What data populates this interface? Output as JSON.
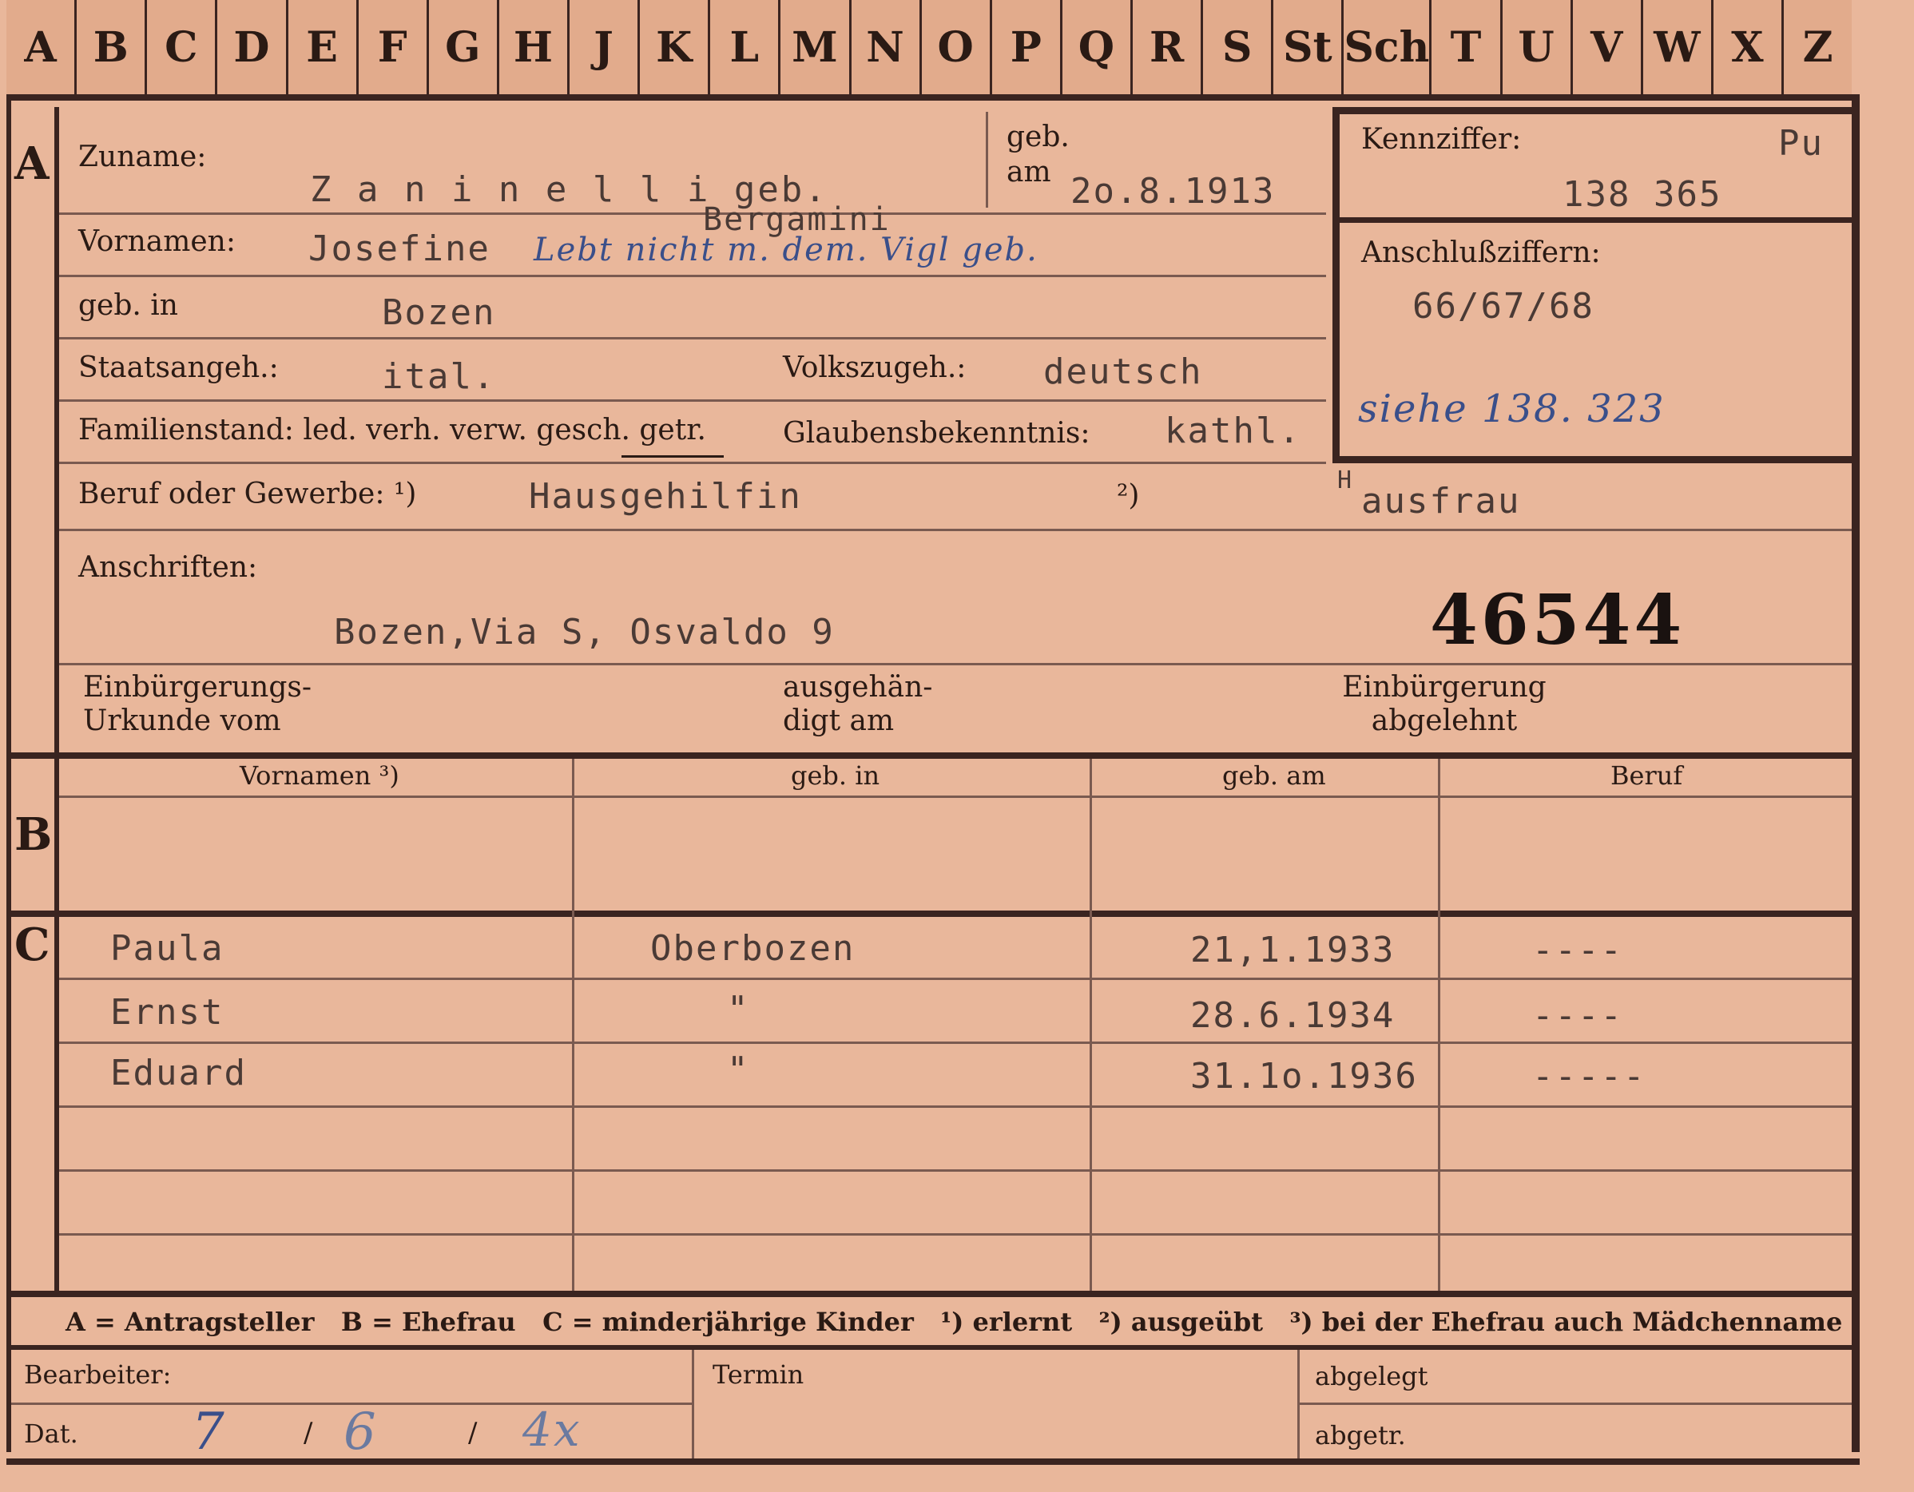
{
  "alphabet": [
    "A",
    "B",
    "C",
    "D",
    "E",
    "F",
    "G",
    "H",
    "J",
    "K",
    "L",
    "M",
    "N",
    "O",
    "P",
    "Q",
    "R",
    "S",
    "St",
    "Sch",
    "T",
    "U",
    "V",
    "W",
    "X",
    "Z"
  ],
  "section_a": {
    "letter": "A",
    "surname_label": "Zuname:",
    "surname_value": "Z a n i n e l l i  geb.",
    "surname_above": "Bergamini",
    "born_on_label": "geb. am",
    "born_on_value": "2o.8.1913",
    "first_names_label": "Vornamen:",
    "first_names_value": "Josefine",
    "first_names_note": "Lebt nicht m. dem. Vigl geb.",
    "born_in_label": "geb. in",
    "born_in_value": "Bozen",
    "citizenship_label": "Staatsangeh.:",
    "citizenship_value": "ital.",
    "ethnicity_label": "Volkszugeh.:",
    "ethnicity_value": "deutsch",
    "marital_label": "Familienstand: led. verh. verw. gesch. getr.",
    "religion_label": "Glaubensbekenntnis:",
    "religion_value": "kathl.",
    "occupation_label": "Beruf oder Gewerbe: ¹)",
    "occupation_value": "Hausgehilfin",
    "occupation2_marker": "²)",
    "occupation2_value": "ausfrau",
    "occupation2_prefix": "H",
    "address_label": "Anschriften:",
    "address_value": "Bozen,Via  S, Osvaldo   9",
    "big_number": "46544",
    "naturalization_label": "Einbürgerungs- Urkunde vom",
    "handed_label": "ausgehän- digt am",
    "rejected_label": "Einbürgerung abgelehnt"
  },
  "id_box": {
    "code_label": "Kennziffer:",
    "code_prefix": "Pu",
    "code_value": "138 365",
    "link_label": "Anschlußziffern:",
    "link_value": "66/67/68",
    "see_note": "siehe 138. 323"
  },
  "section_b": {
    "letter": "B",
    "headers": [
      "Vornamen ³)",
      "geb. in",
      "geb. am",
      "Beruf"
    ]
  },
  "section_c": {
    "letter": "C",
    "rows": [
      {
        "name": "Paula",
        "place": "Oberbozen",
        "date": "21,1.1933",
        "job": "----"
      },
      {
        "name": "Ernst",
        "place": "\"",
        "date": "28.6.1934",
        "job": "----"
      },
      {
        "name": "Eduard",
        "place": "\"",
        "date": "31.1o.1936",
        "job": "-----"
      }
    ]
  },
  "legend": "A = Antragsteller   B = Ehefrau   C = minderjährige Kinder   ¹) erlernt   ²) ausgeübt   ³) bei der Ehefrau auch Mädchenname",
  "footer": {
    "worker_label": "Bearbeiter:",
    "date_label": "Dat.",
    "date_day": "7",
    "date_month": "6",
    "date_year": "4x",
    "date_sep": "/",
    "deadline_label": "Termin",
    "filed_label": "abgelegt",
    "removed_label": "abgetr."
  }
}
